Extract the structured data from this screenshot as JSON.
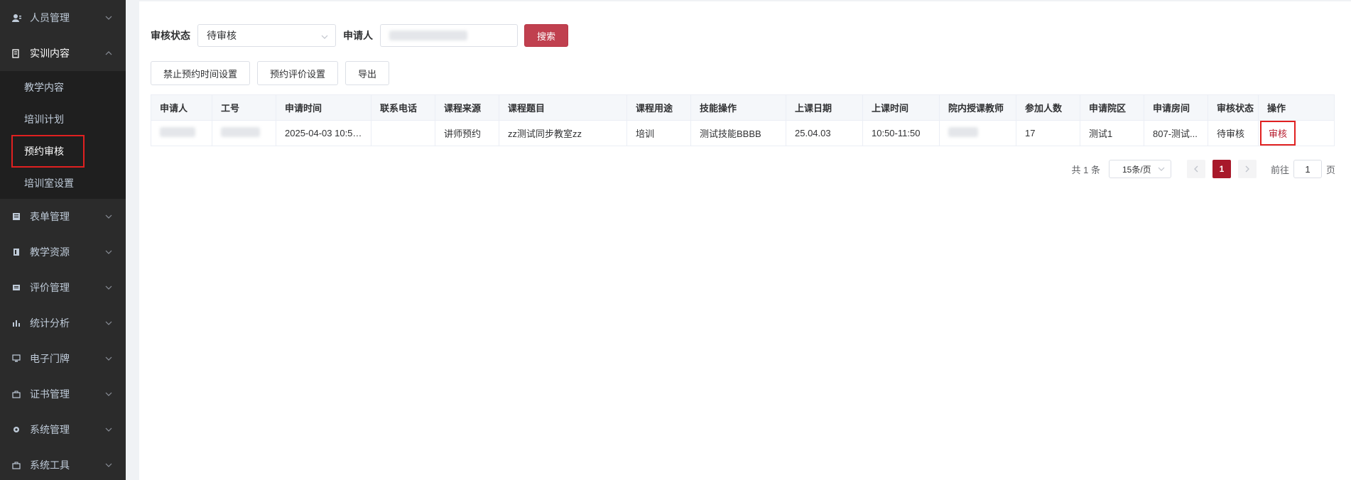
{
  "sidebar": {
    "items": [
      {
        "label": "人员管理",
        "icon": "user-icon"
      },
      {
        "label": "实训内容",
        "icon": "document-icon",
        "open": true,
        "children": [
          {
            "label": "教学内容"
          },
          {
            "label": "培训计划"
          },
          {
            "label": "预约审核",
            "active": true
          },
          {
            "label": "培训室设置"
          }
        ]
      },
      {
        "label": "表单管理",
        "icon": "form-icon"
      },
      {
        "label": "教学资源",
        "icon": "book-icon"
      },
      {
        "label": "评价管理",
        "icon": "comment-icon"
      },
      {
        "label": "统计分析",
        "icon": "bar-chart-icon"
      },
      {
        "label": "电子门牌",
        "icon": "monitor-icon"
      },
      {
        "label": "证书管理",
        "icon": "briefcase-icon"
      },
      {
        "label": "系统管理",
        "icon": "gear-icon"
      },
      {
        "label": "系统工具",
        "icon": "toolbox-icon"
      }
    ]
  },
  "filters": {
    "status_label": "审核状态",
    "status_value": "待审核",
    "applicant_label": "申请人",
    "search_button": "搜索"
  },
  "actions": {
    "disable_time_button": "禁止预约时间设置",
    "rating_button": "预约评价设置",
    "export_button": "导出"
  },
  "table": {
    "columns": [
      "申请人",
      "工号",
      "申请时间",
      "联系电话",
      "课程来源",
      "课程题目",
      "课程用途",
      "技能操作",
      "上课日期",
      "上课时间",
      "院内授课教师",
      "参加人数",
      "申请院区",
      "申请房间",
      "审核状态",
      "操作"
    ],
    "rows": [
      {
        "apply_time": "2025-04-03 10:55...",
        "phone": "",
        "source": "讲师预约",
        "title": "zz测试同步教室zz",
        "purpose": "培训",
        "skill": "测试技能BBBB",
        "date": "25.04.03",
        "time": "10:50-11:50",
        "count": "17",
        "campus": "测试1",
        "room": "807-测试...",
        "status": "待审核",
        "action": "审核"
      }
    ]
  },
  "pagination": {
    "total": "共 1 条",
    "page_size": "15条/页",
    "current_page": "1",
    "goto_label": "前往",
    "goto_value": "1",
    "page_suffix": "页"
  },
  "colors": {
    "sidebar_bg": "#2b2b2b",
    "submenu_bg": "#1f1f1f",
    "primary": "#c0404f",
    "highlight_box": "#e02020"
  }
}
